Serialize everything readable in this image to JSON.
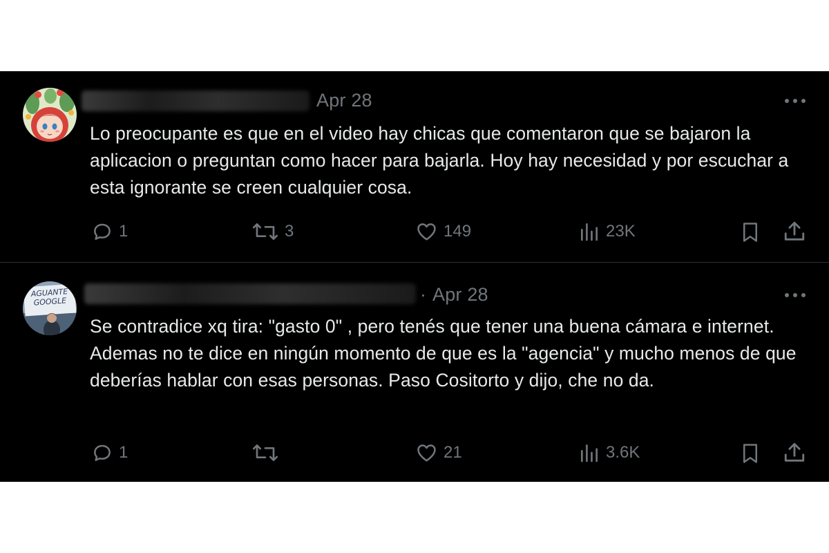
{
  "tweets": [
    {
      "date": "Apr 28",
      "date_separator": "",
      "text": "Lo preocupante es que en el video hay chicas que comentaron que se bajaron la aplicacion o preguntan como hacer para bajarla. Hoy hay necesidad y por escuchar a esta ignorante se creen cualquier cosa.",
      "replies": "1",
      "retweets": "3",
      "likes": "149",
      "views": "23K"
    },
    {
      "date": "Apr 28",
      "date_separator": "·",
      "avatar_sign_text": "AGUANTE GOOGLE",
      "text": "Se contradice xq tira: \"gasto 0\" , pero tenés que tener una buena cámara e internet. Ademas no te dice en ningún momento de que es la \"agencia\" y mucho menos de que deberías hablar con esas personas. Paso Cositorto y dijo, che no da.",
      "replies": "1",
      "retweets": "",
      "likes": "21",
      "views": "3.6K"
    }
  ],
  "icons": {
    "reply": "reply-icon",
    "retweet": "retweet-icon",
    "like": "heart-icon",
    "views": "views-icon",
    "bookmark": "bookmark-icon",
    "share": "share-icon",
    "more": "more-icon"
  },
  "colors": {
    "background": "#000000",
    "text": "#e7e9ea",
    "muted": "#71767b",
    "divider": "#2f3336"
  }
}
